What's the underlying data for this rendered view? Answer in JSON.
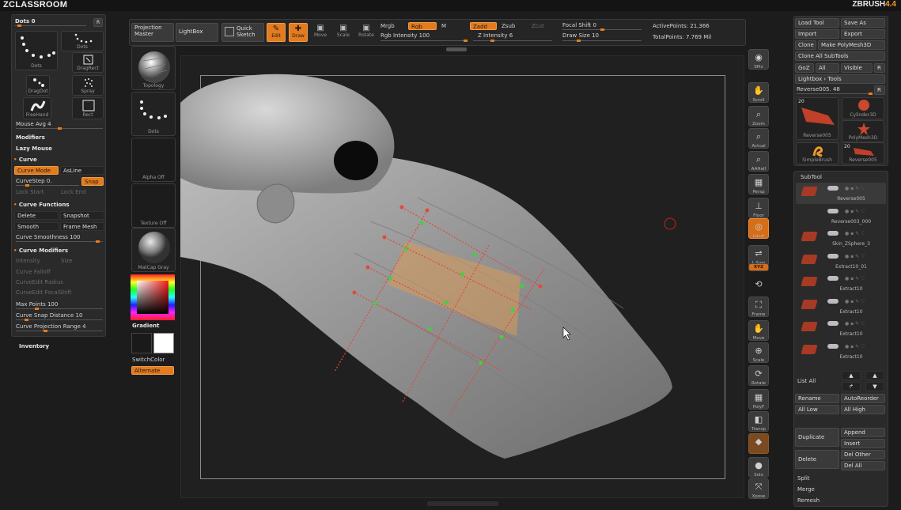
{
  "brand": {
    "left": "ZCLASSROOM",
    "right_main": "ZBRUSH",
    "right_version": "4.4"
  },
  "left_shelf": {
    "dots_label": "Dots",
    "dots_value": "0",
    "r_label": "R",
    "strokes": [
      {
        "label": "Dots",
        "icon": "dots-stroke-icon"
      },
      {
        "label": "Dots",
        "icon": "dots-arc-icon"
      },
      {
        "label": "DragRect",
        "icon": "dragrect-icon"
      },
      {
        "label": "DragDot",
        "icon": "dragdot-icon"
      },
      {
        "label": "Spray",
        "icon": "spray-icon"
      },
      {
        "label": "FreeHand",
        "icon": "freehand-icon"
      },
      {
        "label": "Rect",
        "icon": "rect-icon"
      }
    ],
    "mouse_avg_label": "Mouse Avg 4",
    "modifiers": "Modifiers",
    "lazy_mouse": "Lazy Mouse",
    "curve": "Curve",
    "curve_mode": "Curve Mode",
    "asline": "AsLine",
    "curvestep": "CurveStep 0.",
    "snap": "Snap",
    "lock_start": "Lock Start",
    "lock_end": "Lock End",
    "curve_functions": "Curve Functions",
    "delete": "Delete",
    "snapshot": "Snapshot",
    "smooth": "Smooth",
    "frame_mesh": "Frame Mesh",
    "curve_smoothness": "Curve Smoothness 100",
    "curve_modifiers": "Curve Modifiers",
    "intensity": "Intensity",
    "size": "Size",
    "curve_falloff": "Curve Falloff",
    "curveedit_radius": "CurveEdit Radius",
    "curveedit_focalshift": "CurveEdit FocalShift",
    "max_points": "Max Points 100",
    "curve_snap_distance": "Curve Snap Distance 10",
    "curve_projection_range": "Curve Projection Range 4",
    "inventory": "Inventory"
  },
  "left_tray": {
    "topology_label": "Topology",
    "dots_label": "Dots",
    "alpha_label": "Alpha Off",
    "texture_label": "Texture Off",
    "matcap_label": "MatCap Gray",
    "gradient": "Gradient",
    "switchcolor": "SwitchColor",
    "alternate": "Alternate",
    "main_color": "#1a1a1a",
    "secondary_color": "#ffffff"
  },
  "top_shelf": {
    "projection_master": "Projection Master",
    "lightbox": "LightBox",
    "quick_sketch": "Quick Sketch",
    "edit": "Edit",
    "draw": "Draw",
    "move": "Move",
    "scale": "Scale",
    "rotate": "Rotate",
    "mrgb": "Mrgb",
    "rgb": "Rgb",
    "m": "M",
    "rgb_intensity": "Rgb Intensity 100",
    "zadd": "Zadd",
    "zsub": "Zsub",
    "zcut": "Zcut",
    "z_intensity": "Z Intensity 6",
    "focal_shift": "Focal Shift 0",
    "draw_size": "Draw Size 10",
    "active_points": "ActivePoints: 21,366",
    "total_points": "TotalPoints: 7.769 Mil"
  },
  "right_tools": [
    {
      "label": "SPix",
      "glyph": "◉",
      "icon": "spix-icon"
    },
    {
      "label": "Scroll",
      "glyph": "✋",
      "icon": "scroll-icon"
    },
    {
      "label": "Zoom",
      "glyph": "⌕",
      "icon": "zoom-icon"
    },
    {
      "label": "Actual",
      "glyph": "⌕",
      "icon": "actual-icon"
    },
    {
      "label": "AAHalf",
      "glyph": "⌕",
      "icon": "aahalf-icon"
    },
    {
      "label": "Persp",
      "glyph": "▦",
      "icon": "persp-icon"
    },
    {
      "label": "Floor",
      "glyph": "⊥",
      "icon": "floor-icon"
    },
    {
      "label": "Local",
      "glyph": "◎",
      "icon": "local-icon"
    },
    {
      "label": "L.Sym",
      "glyph": "⇌",
      "icon": "lsym-icon"
    },
    {
      "label": "XYZ",
      "glyph": "",
      "icon": "xyz-icon"
    },
    {
      "label": "",
      "glyph": "⟲",
      "icon": "rotate-axis-icon"
    },
    {
      "label": "Frame",
      "glyph": "⛶",
      "icon": "frame-icon"
    },
    {
      "label": "Move",
      "glyph": "✋",
      "icon": "move-icon"
    },
    {
      "label": "Scale",
      "glyph": "⊕",
      "icon": "scale-icon"
    },
    {
      "label": "Rotate",
      "glyph": "⟳",
      "icon": "rotate-icon"
    },
    {
      "label": "PolyF",
      "glyph": "▦",
      "icon": "polyf-icon"
    },
    {
      "label": "Transp",
      "glyph": "◧",
      "icon": "transp-icon"
    },
    {
      "label": "",
      "glyph": "◆",
      "icon": "ghost-icon"
    },
    {
      "label": "Solo",
      "glyph": "●",
      "icon": "solo-icon"
    },
    {
      "label": "Xpose",
      "glyph": "⤧",
      "icon": "xpose-icon"
    }
  ],
  "tool_panel": {
    "load_tool": "Load Tool",
    "save_as": "Save As",
    "import": "Import",
    "export": "Export",
    "clone": "Clone",
    "make_polymesh": "Make PolyMesh3D",
    "clone_all_subtools": "Clone All SubTools",
    "goz": "GoZ",
    "all": "All",
    "visible": "Visible",
    "r": "R",
    "lightbox_tools": "Lightbox › Tools",
    "current_tool": "Reverse005. 48",
    "thumbs": [
      {
        "label": "Reverse005",
        "count": "20"
      },
      {
        "label": "Cylinder3D",
        "count": ""
      },
      {
        "label": "PolyMesh3D",
        "count": ""
      },
      {
        "label": "SimpleBrush",
        "count": ""
      },
      {
        "label": "Reverse005",
        "count": "20"
      }
    ]
  },
  "subtool": {
    "title": "SubTool",
    "items": [
      "Reverse005",
      "Reverse003_000",
      "Skin_ZSphere_3",
      "Extract10_01",
      "Extract10",
      "Extract10",
      "Extract10",
      "Extract10"
    ],
    "list_all": "List All",
    "rename": "Rename",
    "autoreorder": "AutoReorder",
    "all_low": "All Low",
    "all_high": "All High",
    "duplicate": "Duplicate",
    "append": "Append",
    "insert": "Insert",
    "delete": "Delete",
    "del_other": "Del Other",
    "del_all": "Del All",
    "split": "Split",
    "merge": "Merge",
    "remesh": "Remesh"
  },
  "colors": {
    "accent": "#ec7a1b",
    "background": "#1c1c1c",
    "panel": "#2a2a2a",
    "curve_red": "#e04a3a",
    "curve_green": "#3fd23f",
    "stroke_fill": "#d89a5a"
  }
}
